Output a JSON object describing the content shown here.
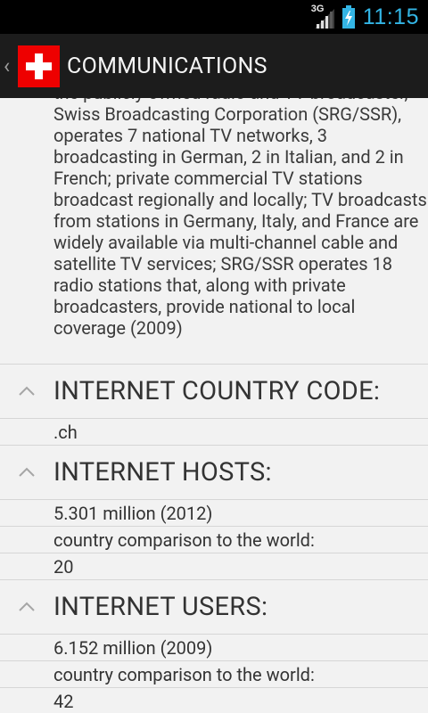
{
  "status": {
    "network": "3G",
    "time": "11:15"
  },
  "actionbar": {
    "title": "COMMUNICATIONS",
    "up_icon": "chevron-left-icon",
    "logo": "swiss-flag"
  },
  "content": {
    "intro_text": "the publicly owned radio and TV broadcaster, Swiss Broadcasting Corporation (SRG/SSR), operates 7 national TV networks, 3 broadcasting in German, 2 in Italian, and 2 in French; private commercial TV stations broadcast regionally and locally; TV broadcasts from stations in Germany, Italy, and France are widely available via multi-channel cable and satellite TV services; SRG/SSR operates 18 radio stations that, along with private broadcasters, provide national to local coverage (2009)",
    "sections": [
      {
        "title": "INTERNET COUNTRY CODE:",
        "values": [
          ".ch"
        ]
      },
      {
        "title": "INTERNET HOSTS:",
        "values": [
          "5.301 million (2012)",
          "country comparison to the world:",
          "20"
        ]
      },
      {
        "title": "INTERNET USERS:",
        "values": [
          "6.152 million (2009)",
          "country comparison to the world:",
          "42"
        ]
      }
    ]
  }
}
